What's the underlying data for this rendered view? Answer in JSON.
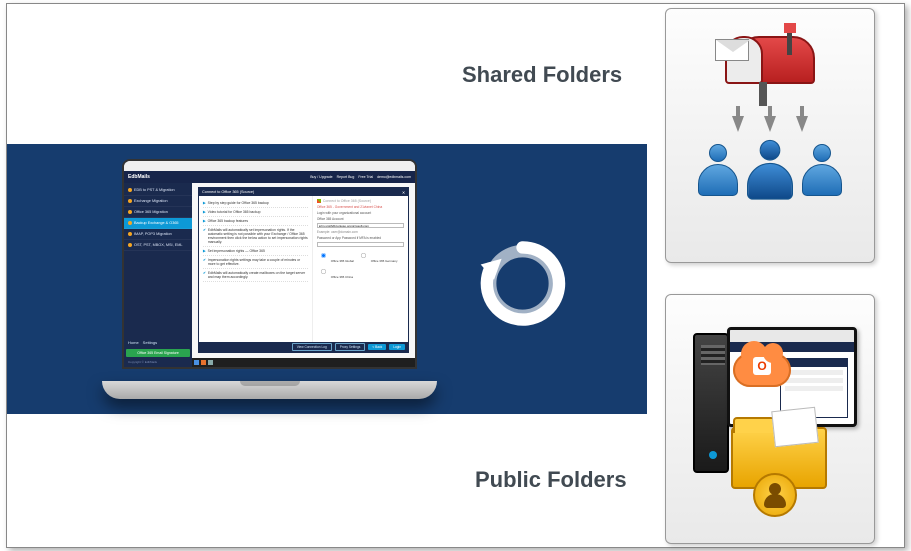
{
  "labels": {
    "shared": "Shared Folders",
    "public": "Public Folders"
  },
  "app": {
    "brand": "EdbMails",
    "topbar_links": [
      "Buy / Upgrade",
      "Report Bug",
      "Free Trial",
      "demo@edbmails.com"
    ],
    "sidebar": [
      "EDB to PST & Migration",
      "Exchange Migration",
      "Office 365 Migration",
      "Backup Exchange & O365",
      "IMAP, POP3 Migration",
      "OST, PST, MBOX, MSI, EML"
    ],
    "sidebar_selected_index": 3,
    "sidebar_footer": [
      "Home",
      "Settings"
    ],
    "green_button": "Office 365 Email Signature",
    "copyright": "Copyright © EdbMails"
  },
  "dialog": {
    "title": "Connect to Office 365 (Source)",
    "close_glyph": "✕",
    "left_items": [
      "Step by step guide for Office 365 backup",
      "Video tutorial for Office 365 backup",
      "Office 365 backup features",
      "EdbMails will automatically set impersonation rights. If the automatic setting is not possible with your Exchange / Office 365 environment then click the below action to set impersonation rights manually.",
      "Set impersonation rights — Office 365",
      "Impersonation rights settings may take a couple of minutes or more to get effective.",
      "EdbMails will automatically create mailboxes on the target server and map them accordingly."
    ],
    "right": {
      "logo_text": "Connect to Office 365 (Source)",
      "red_notice": "Office 365 - Government and 21vianet China",
      "login_heading": "Login with your organizational account",
      "account_label": "Office 365 Account",
      "account_value": "john.smith@contoso.onmicrosoft.com",
      "example_hint": "Example: user@domain.com",
      "password_label": "Password or App Password if MFA is enabled",
      "radio_global": "Office 365 Global",
      "radio_germany": "Office 365 Germany",
      "radio_china": "Office 365 China"
    },
    "footer_buttons": [
      "View Connection Log",
      "Proxy Settings",
      "< Back",
      "Login"
    ]
  }
}
